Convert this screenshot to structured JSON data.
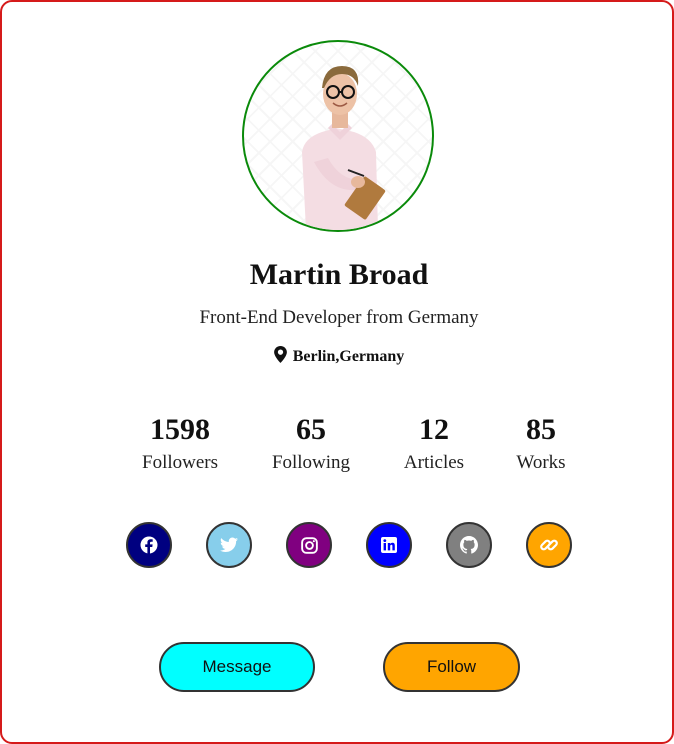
{
  "profile": {
    "name": "Martin Broad",
    "role": "Front-End Developer from Germany",
    "location": "Berlin,Germany"
  },
  "stats": [
    {
      "value": "1598",
      "label": "Followers"
    },
    {
      "value": "65",
      "label": "Following"
    },
    {
      "value": "12",
      "label": "Articles"
    },
    {
      "value": "85",
      "label": "Works"
    }
  ],
  "social": [
    {
      "icon": "facebook-icon",
      "color": "#000080"
    },
    {
      "icon": "twitter-icon",
      "color": "#87ceeb"
    },
    {
      "icon": "instagram-icon",
      "color": "#800080"
    },
    {
      "icon": "linkedin-icon",
      "color": "#0000ff"
    },
    {
      "icon": "github-icon",
      "color": "#808080"
    },
    {
      "icon": "link-icon",
      "color": "#ffa500"
    }
  ],
  "buttons": {
    "message": {
      "label": "Message",
      "color": "#00ffff"
    },
    "follow": {
      "label": "Follow",
      "color": "#ffa500"
    }
  },
  "colors": {
    "card_border": "#d51a1a",
    "avatar_ring": "#0a8a0a"
  }
}
